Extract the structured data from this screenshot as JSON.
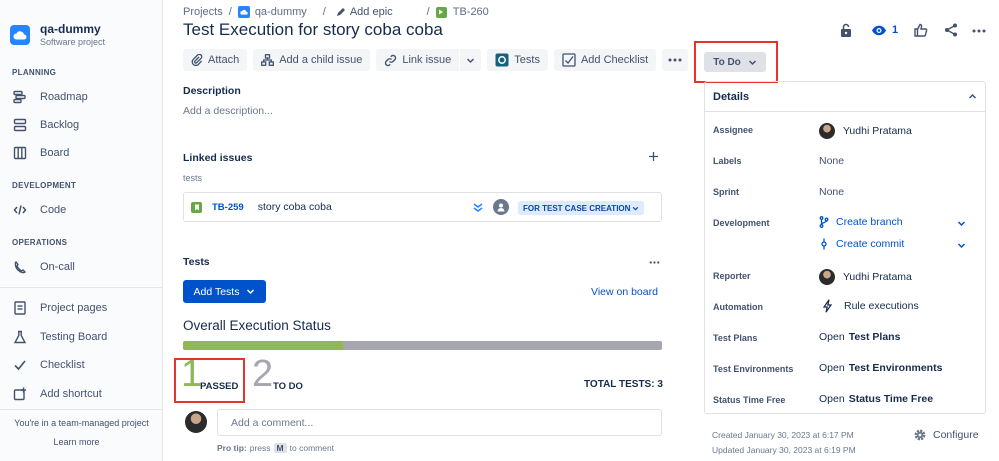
{
  "sidebar": {
    "project_name": "qa-dummy",
    "project_type": "Software project",
    "sections": {
      "planning": "PLANNING",
      "development": "DEVELOPMENT",
      "operations": "OPERATIONS"
    },
    "items": {
      "roadmap": "Roadmap",
      "backlog": "Backlog",
      "board": "Board",
      "code": "Code",
      "on_call": "On-call",
      "project_pages": "Project pages",
      "testing_board": "Testing Board",
      "checklist": "Checklist",
      "add_shortcut": "Add shortcut"
    },
    "team_note": "You're in a team-managed project",
    "learn_more": "Learn more"
  },
  "breadcrumb": {
    "projects": "Projects",
    "sep": "/",
    "project": "qa-dummy",
    "add_epic": "Add epic",
    "issue_key": "TB-260"
  },
  "issue": {
    "title": "Test Execution for story coba coba",
    "toolbar": {
      "attach": "Attach",
      "add_child": "Add a child issue",
      "link_issue": "Link issue",
      "tests": "Tests",
      "add_checklist": "Add Checklist"
    },
    "description_label": "Description",
    "description_placeholder": "Add a description...",
    "linked_label": "Linked issues",
    "link_type": "tests",
    "linked_key": "TB-259",
    "linked_summary": "story coba coba",
    "linked_status": "FOR TEST CASE CREATION"
  },
  "tests_panel": {
    "label": "Tests",
    "add_tests": "Add Tests",
    "view_on_board": "View on board",
    "overall_title": "Overall Execution Status",
    "passed_count": "1",
    "passed_label": "PASSED",
    "todo_count": "2",
    "todo_label": "TO DO",
    "total_label": "TOTAL TESTS: 3",
    "passed_fraction": 0.3333,
    "passed_color": "#8fb859",
    "todo_color": "#a5a6ae"
  },
  "comment": {
    "placeholder": "Add a comment...",
    "pro_tip_prefix": "Pro tip:",
    "pro_tip_press": "press",
    "pro_tip_key": "M",
    "pro_tip_suffix": "to comment"
  },
  "header_actions": {
    "watch_count": "1"
  },
  "status": {
    "value": "To Do"
  },
  "details": {
    "title": "Details",
    "assignee_label": "Assignee",
    "assignee": "Yudhi Pratama",
    "labels_label": "Labels",
    "labels": "None",
    "sprint_label": "Sprint",
    "sprint": "None",
    "development_label": "Development",
    "create_branch": "Create branch",
    "create_commit": "Create commit",
    "reporter_label": "Reporter",
    "reporter": "Yudhi Pratama",
    "automation_label": "Automation",
    "rule_executions": "Rule executions",
    "test_plans_label": "Test Plans",
    "test_plans_prefix": "Open",
    "test_plans_value": "Test Plans",
    "test_env_label": "Test Environments",
    "test_env_prefix": "Open",
    "test_env_value": "Test Environments",
    "status_time_label": "Status Time Free",
    "status_time_prefix": "Open",
    "status_time_value": "Status Time Free"
  },
  "footer": {
    "created": "Created January 30, 2023 at 6:17 PM",
    "updated": "Updated January 30, 2023 at 6:19 PM",
    "configure": "Configure"
  }
}
